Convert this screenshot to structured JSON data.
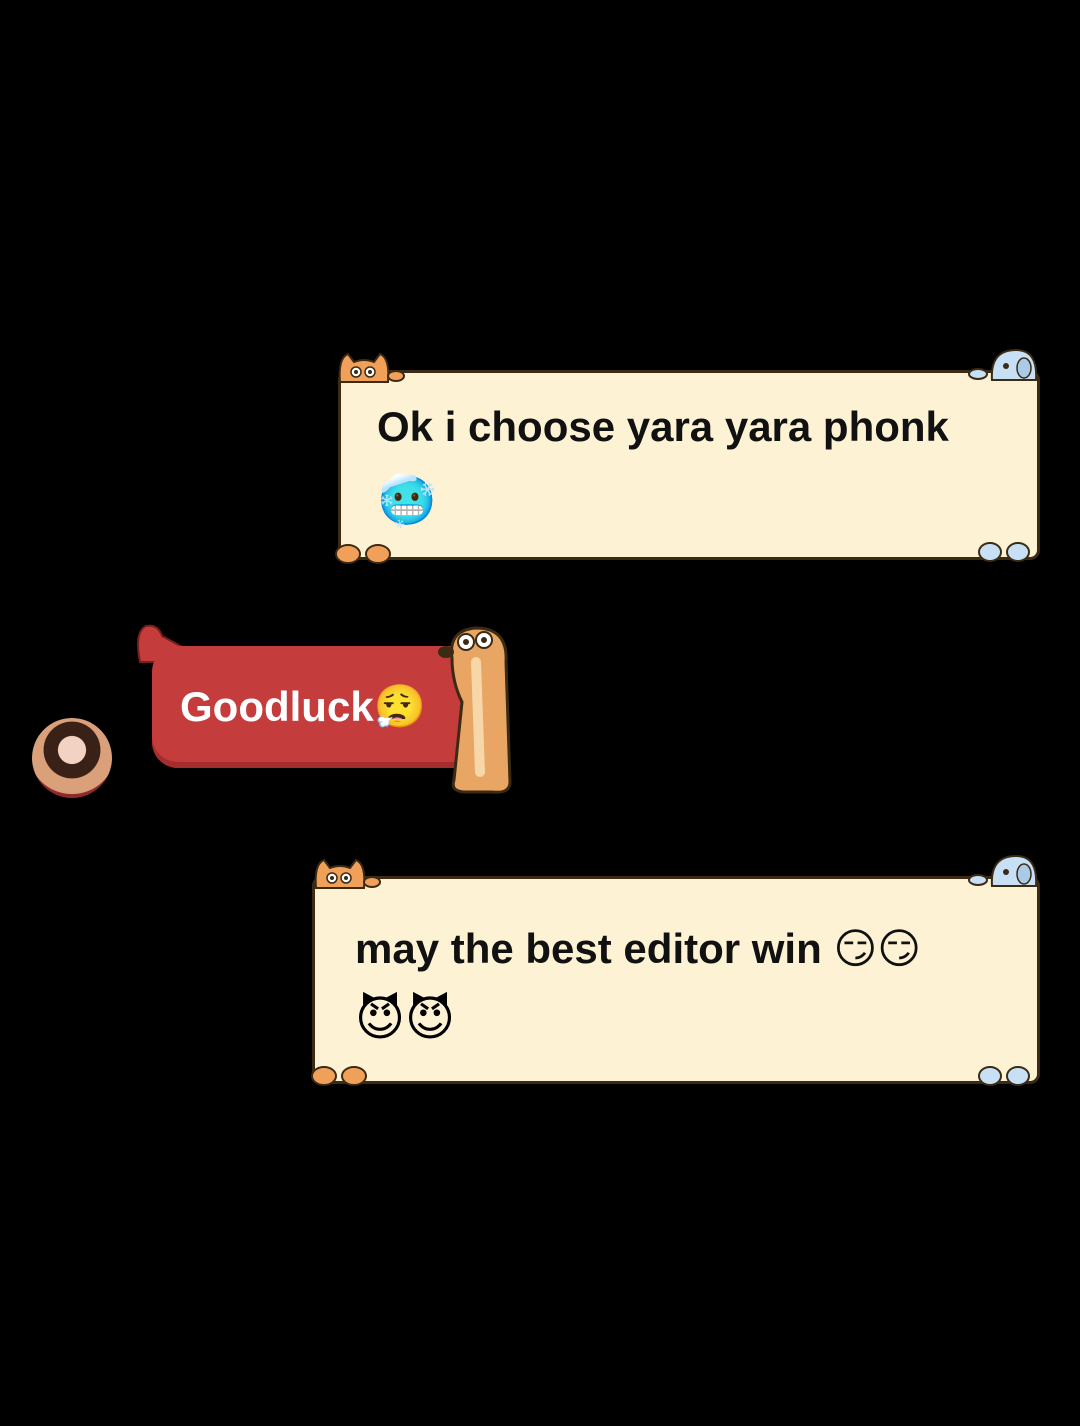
{
  "messages": [
    {
      "side": "outgoing",
      "text": "Ok i choose yara yara phonk",
      "emoji": "🥶"
    },
    {
      "side": "incoming",
      "text": "Goodluck",
      "emoji": "😮‍💨"
    },
    {
      "side": "outgoing",
      "text": "may the best editor win",
      "text_emoji": "😏😏",
      "emoji": "😈😈"
    }
  ],
  "colors": {
    "background": "#000000",
    "outgoing_bubble": "#fdf3d4",
    "outgoing_border": "#3b2a14",
    "incoming_bubble": "#c43c3c",
    "incoming_text": "#ffffff"
  },
  "icons": {
    "cat": "cat-icon",
    "dog": "dog-icon",
    "paw": "paw-icon",
    "avatar": "avatar"
  }
}
